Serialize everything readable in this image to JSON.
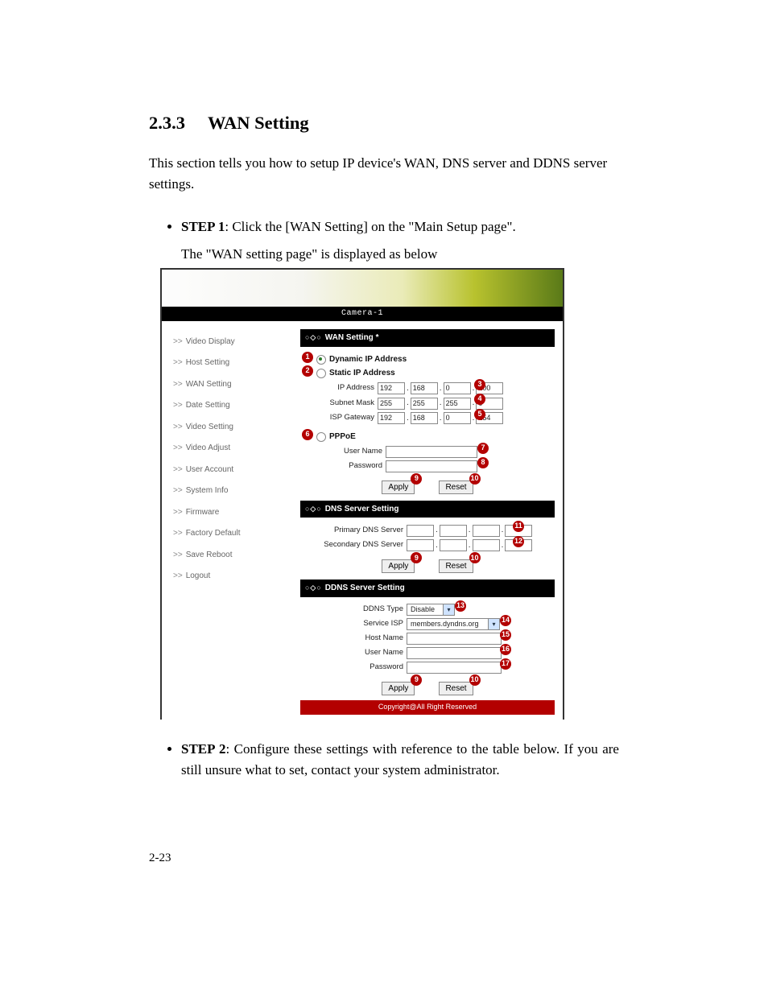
{
  "page_number": "2-23",
  "heading": {
    "number": "2.3.3",
    "title": "WAN Setting"
  },
  "intro": "This section tells you how to setup IP device's WAN, DNS server and DDNS server settings.",
  "step1": {
    "label": "STEP 1",
    "text": ": Click the [WAN Setting] on the \"Main Setup page\".",
    "sub": "The \"WAN setting page\" is displayed as below"
  },
  "step2": {
    "label": "STEP 2",
    "text": ": Configure these settings with reference to the table below. If you are still unsure what to set, contact your system administrator."
  },
  "screenshot": {
    "title_bar": "Camera-1",
    "sidebar": [
      "Video Display",
      "Host Setting",
      "WAN Setting",
      "Date Setting",
      "Video Setting",
      "Video Adjust",
      "User Account",
      "System Info",
      "Firmware",
      "Factory Default",
      "Save Reboot",
      "Logout"
    ],
    "wan": {
      "header": "WAN Setting *",
      "radio_dynamic": "Dynamic IP Address",
      "radio_static": "Static IP Address",
      "radio_pppoe": "PPPoE",
      "ip_label": "IP Address",
      "ip": [
        "192",
        "168",
        "0",
        "100"
      ],
      "mask_label": "Subnet Mask",
      "mask": [
        "255",
        "255",
        "255",
        "0"
      ],
      "gw_label": "ISP Gateway",
      "gw": [
        "192",
        "168",
        "0",
        "254"
      ],
      "user_label": "User Name",
      "pass_label": "Password"
    },
    "dns": {
      "header": "DNS Server Setting",
      "primary_label": "Primary DNS Server",
      "secondary_label": "Secondary DNS Server"
    },
    "ddns": {
      "header": "DDNS Server Setting",
      "type_label": "DDNS Type",
      "type_value": "Disable",
      "isp_label": "Service ISP",
      "isp_value": "members.dyndns.org",
      "host_label": "Host Name",
      "user_label": "User Name",
      "pass_label": "Password"
    },
    "buttons": {
      "apply": "Apply",
      "reset": "Reset"
    },
    "footer": "Copyright@All Right Reserved",
    "callouts": {
      "c1": "1",
      "c2": "2",
      "c3": "3",
      "c4": "4",
      "c5": "5",
      "c6": "6",
      "c7": "7",
      "c8": "8",
      "c9": "9",
      "c10": "10",
      "c11": "11",
      "c12": "12",
      "c13": "13",
      "c14": "14",
      "c15": "15",
      "c16": "16",
      "c17": "17"
    }
  }
}
